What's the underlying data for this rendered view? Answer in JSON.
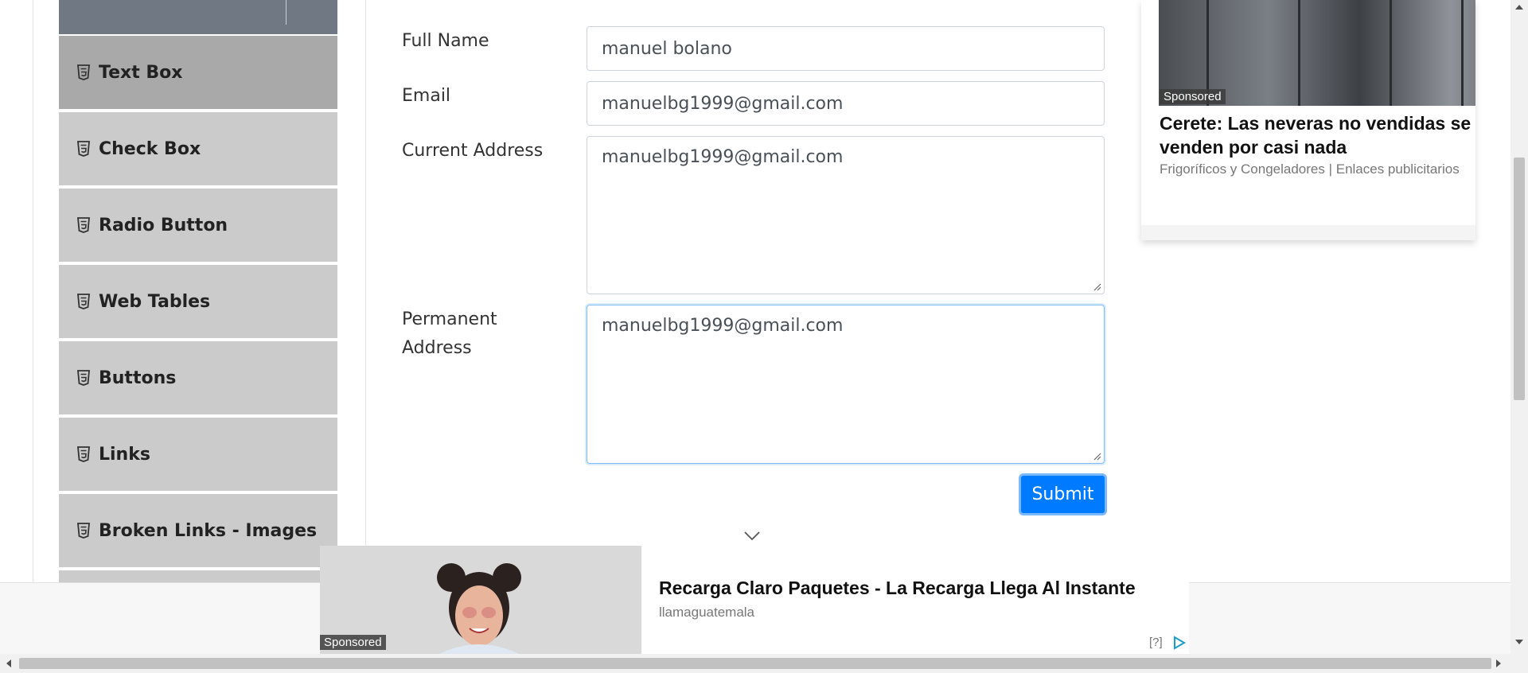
{
  "sidebar": {
    "items": [
      {
        "label": "Text Box",
        "icon": "html5-icon",
        "active": true
      },
      {
        "label": "Check Box",
        "icon": "html5-icon"
      },
      {
        "label": "Radio Button",
        "icon": "html5-icon"
      },
      {
        "label": "Web Tables",
        "icon": "html5-icon"
      },
      {
        "label": "Buttons",
        "icon": "html5-icon"
      },
      {
        "label": "Links",
        "icon": "html5-icon"
      },
      {
        "label": "Broken Links - Images",
        "icon": "html5-icon"
      }
    ]
  },
  "form": {
    "full_name": {
      "label": "Full Name",
      "value": "manuel bolano"
    },
    "email": {
      "label": "Email",
      "value": "manuelbg1999@gmail.com"
    },
    "current_address": {
      "label": "Current Address",
      "value": "manuelbg1999@gmail.com"
    },
    "permanent_address": {
      "label_line1": "Permanent",
      "label_line2": "Address",
      "value": "manuelbg1999@gmail.com"
    },
    "submit_label": "Submit"
  },
  "ad_right": {
    "sponsored": "Sponsored",
    "title": "Cerete: Las neveras no vendidas se venden por casi nada",
    "source": "Frigoríficos y Congeladores | Enlaces publicitarios",
    "marker": "[?]"
  },
  "ad_bottom": {
    "sponsored": "Sponsored",
    "title": "Recarga Claro Paquetes - La Recarga Llega Al Instante",
    "source": "llamaguatemala",
    "marker": "[?]"
  },
  "colors": {
    "primary": "#007bff",
    "sidebar_item": "#cbcbcb",
    "sidebar_active": "#a9a9a9",
    "sidebar_header": "#707884"
  }
}
